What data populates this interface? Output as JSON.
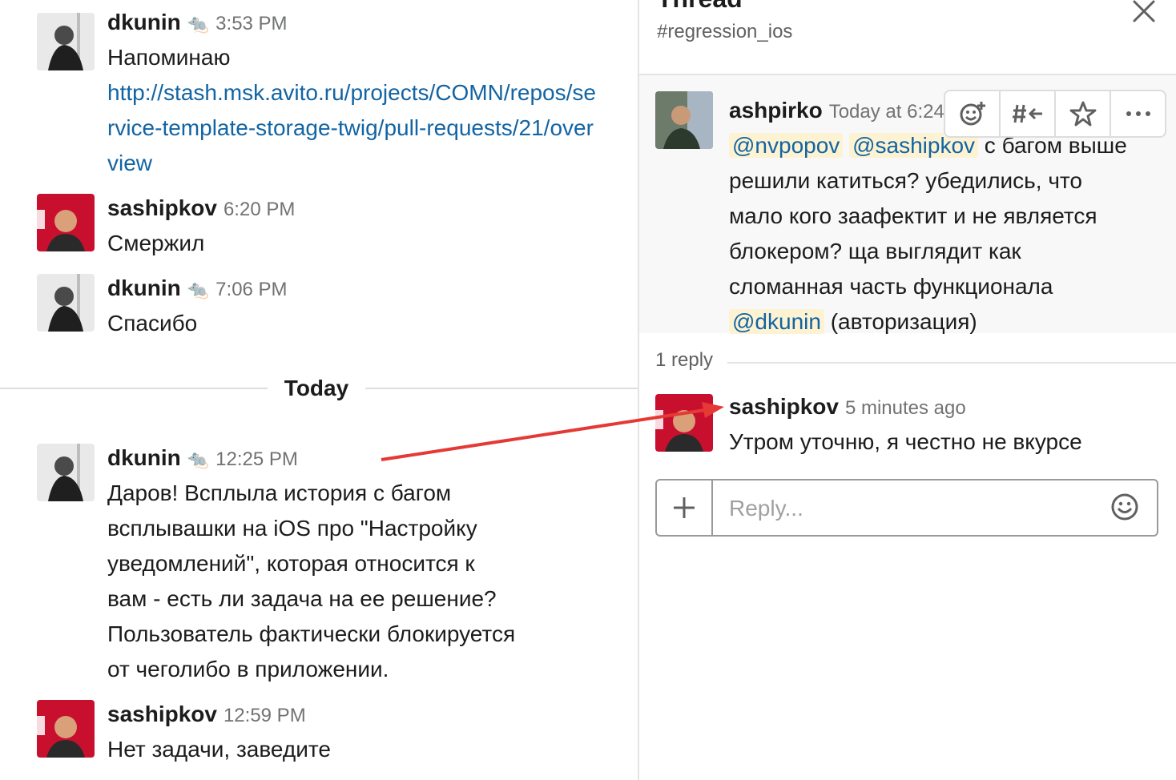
{
  "channel": {
    "messages": [
      {
        "user": "dkunin",
        "emoji": "🐀",
        "time": "3:53 PM",
        "text": "Напоминаю",
        "link": "http://stash.msk.avito.ru/projects/COMN/repos/service-template-storage-twig/pull-requests/21/overview"
      },
      {
        "user": "sashipkov",
        "time": "6:20 PM",
        "text": "Смержил"
      },
      {
        "user": "dkunin",
        "emoji": "🐀",
        "time": "7:06 PM",
        "text": "Спасибо"
      },
      {
        "user": "dkunin",
        "emoji": "🐀",
        "time": "12:25 PM",
        "text": "Даров! Всплыла история  с багом всплывашки на iOS про \"Настройку уведомлений\", которая относится к вам - есть ли задача на ее решение? Пользователь фактически блокируется от чеголибо в приложении."
      },
      {
        "user": "sashipkov",
        "time": "12:59 PM",
        "text": "Нет задачи, заведите"
      }
    ],
    "divider_label": "Today"
  },
  "thread": {
    "title": "Thread",
    "channel": "#regression_ios",
    "parent": {
      "user": "ashpirko",
      "time": "Today at 6:24",
      "mention1": "@nvpopov",
      "mention2": "@sashipkov",
      "text1": "с багом выше решили катиться? убедились, что мало кого заафектит и не является блокером? ща выглядит как сломанная часть функционала",
      "mention3": "@dkunin",
      "text2": "(авторизация)"
    },
    "reply_count": "1 reply",
    "reply": {
      "user": "sashipkov",
      "time": "5 minutes ago",
      "text": "Утром уточню, я честно не вкурсе"
    },
    "composer_placeholder": "Reply..."
  },
  "icons": {
    "close": "close-icon",
    "add_reaction": "add-reaction-icon",
    "share": "share-to-channel-icon",
    "star": "star-icon",
    "more": "more-actions-icon",
    "plus": "plus-icon",
    "emoji": "emoji-icon"
  },
  "colors": {
    "link": "#1264a3",
    "mention_bg": "#fdf3d3",
    "annotation_arrow": "#e53935",
    "avatar_red": "#c8102e"
  }
}
